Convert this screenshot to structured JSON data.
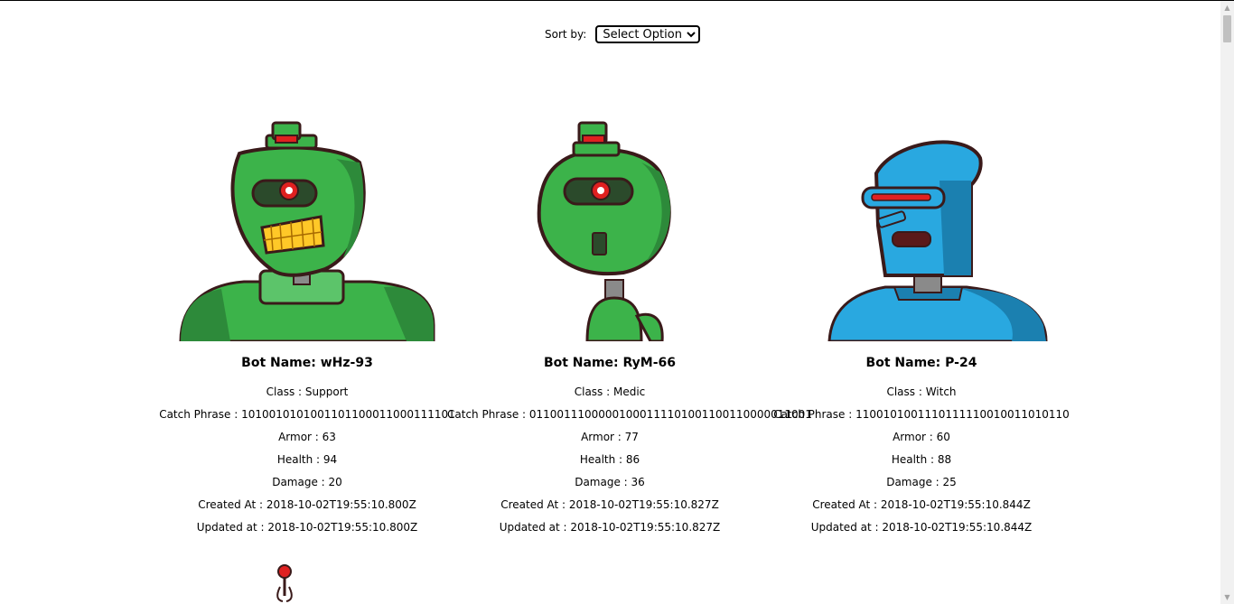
{
  "sort": {
    "label": "Sort by:",
    "selected": "Select Option"
  },
  "bots": [
    {
      "name_line": "Bot Name: wHz-93",
      "class_line": "Class : Support",
      "catch_line": "Catch Phrase : 1010010101001101100011000111101",
      "armor_line": "Armor : 63",
      "health_line": "Health : 94",
      "damage_line": "Damage : 20",
      "created_line": "Created At : 2018-10-02T19:55:10.800Z",
      "updated_line": "Updated at : 2018-10-02T19:55:10.800Z",
      "color": "#3cb34a"
    },
    {
      "name_line": "Bot Name: RyM-66",
      "class_line": "Class : Medic",
      "catch_line": "Catch Phrase : 01100111000001000111101001100110000011001",
      "armor_line": "Armor : 77",
      "health_line": "Health : 86",
      "damage_line": "Damage : 36",
      "created_line": "Created At : 2018-10-02T19:55:10.827Z",
      "updated_line": "Updated at : 2018-10-02T19:55:10.827Z",
      "color": "#3cb34a"
    },
    {
      "name_line": "Bot Name: P-24",
      "class_line": "Class : Witch",
      "catch_line": "Catch Phrase : 1100101001110111110010011010110",
      "armor_line": "Armor : 60",
      "health_line": "Health : 88",
      "damage_line": "Damage : 25",
      "created_line": "Created At : 2018-10-02T19:55:10.844Z",
      "updated_line": "Updated at : 2018-10-02T19:55:10.844Z",
      "color": "#29a8e0"
    }
  ]
}
